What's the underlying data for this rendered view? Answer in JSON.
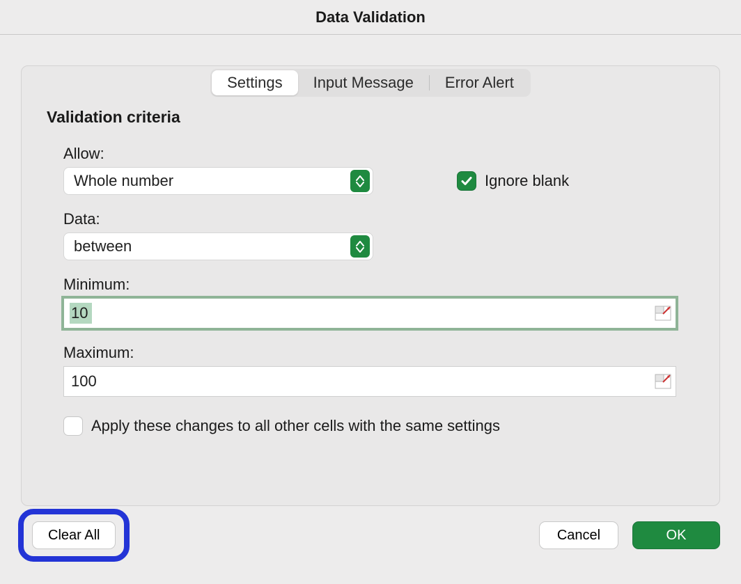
{
  "title": "Data Validation",
  "tabs": {
    "settings": "Settings",
    "input_message": "Input Message",
    "error_alert": "Error Alert"
  },
  "section_title": "Validation criteria",
  "labels": {
    "allow": "Allow:",
    "data": "Data:",
    "minimum": "Minimum:",
    "maximum": "Maximum:"
  },
  "select": {
    "allow_value": "Whole number",
    "data_value": "between"
  },
  "checkbox": {
    "ignore_blank": "Ignore blank",
    "apply_all": "Apply these changes to all other cells with the same settings"
  },
  "inputs": {
    "minimum": "10",
    "maximum": "100"
  },
  "buttons": {
    "clear_all": "Clear All",
    "cancel": "Cancel",
    "ok": "OK"
  },
  "colors": {
    "accent_green": "#1f8a40",
    "highlight_blue": "#2334d6"
  }
}
